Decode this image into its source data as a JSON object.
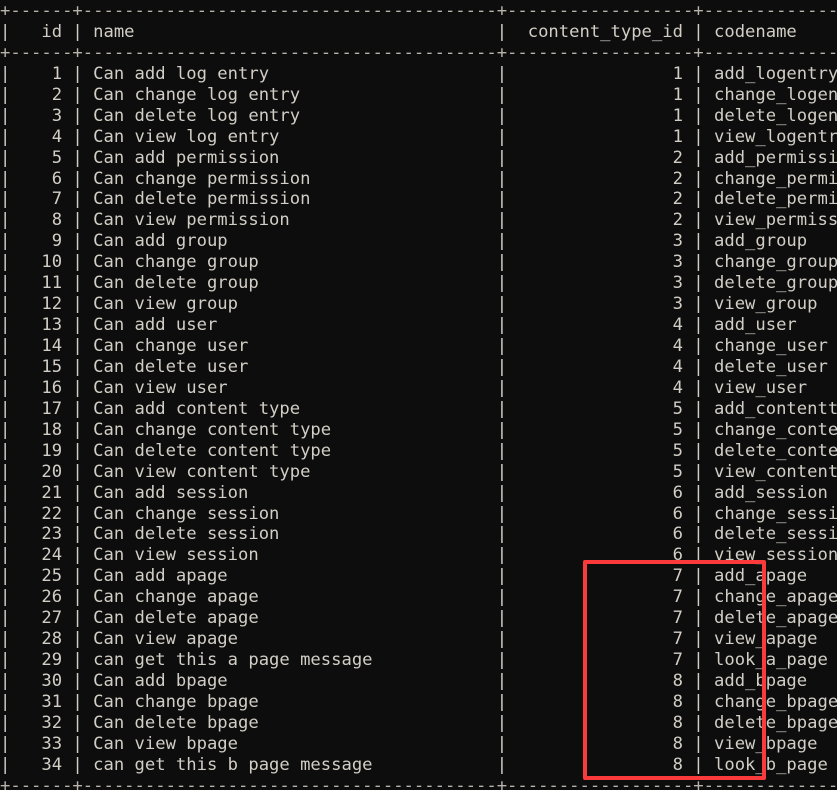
{
  "terminal": {
    "background_color": "#0d0d0d",
    "text_color": "#d2cec6",
    "rule_color": "#b9b4ab",
    "highlight_color": "#fb3b3b"
  },
  "table": {
    "columns": [
      {
        "key": "id",
        "header": "id",
        "width": 4,
        "align": "right"
      },
      {
        "key": "name",
        "header": "name",
        "width": 38,
        "align": "left"
      },
      {
        "key": "content_type_id",
        "header": "content_type_id",
        "width": 16,
        "align": "right"
      },
      {
        "key": "codename",
        "header": "codename",
        "width": 26,
        "align": "left"
      }
    ],
    "rows": [
      {
        "id": "1",
        "name": "Can add log entry",
        "content_type_id": "1",
        "codename": "add_logentry"
      },
      {
        "id": "2",
        "name": "Can change log entry",
        "content_type_id": "1",
        "codename": "change_logentry"
      },
      {
        "id": "3",
        "name": "Can delete log entry",
        "content_type_id": "1",
        "codename": "delete_logentry"
      },
      {
        "id": "4",
        "name": "Can view log entry",
        "content_type_id": "1",
        "codename": "view_logentry"
      },
      {
        "id": "5",
        "name": "Can add permission",
        "content_type_id": "2",
        "codename": "add_permission"
      },
      {
        "id": "6",
        "name": "Can change permission",
        "content_type_id": "2",
        "codename": "change_permission"
      },
      {
        "id": "7",
        "name": "Can delete permission",
        "content_type_id": "2",
        "codename": "delete_permission"
      },
      {
        "id": "8",
        "name": "Can view permission",
        "content_type_id": "2",
        "codename": "view_permission"
      },
      {
        "id": "9",
        "name": "Can add group",
        "content_type_id": "3",
        "codename": "add_group"
      },
      {
        "id": "10",
        "name": "Can change group",
        "content_type_id": "3",
        "codename": "change_group"
      },
      {
        "id": "11",
        "name": "Can delete group",
        "content_type_id": "3",
        "codename": "delete_group"
      },
      {
        "id": "12",
        "name": "Can view group",
        "content_type_id": "3",
        "codename": "view_group"
      },
      {
        "id": "13",
        "name": "Can add user",
        "content_type_id": "4",
        "codename": "add_user"
      },
      {
        "id": "14",
        "name": "Can change user",
        "content_type_id": "4",
        "codename": "change_user"
      },
      {
        "id": "15",
        "name": "Can delete user",
        "content_type_id": "4",
        "codename": "delete_user"
      },
      {
        "id": "16",
        "name": "Can view user",
        "content_type_id": "4",
        "codename": "view_user"
      },
      {
        "id": "17",
        "name": "Can add content type",
        "content_type_id": "5",
        "codename": "add_contenttype"
      },
      {
        "id": "18",
        "name": "Can change content type",
        "content_type_id": "5",
        "codename": "change_contenttype"
      },
      {
        "id": "19",
        "name": "Can delete content type",
        "content_type_id": "5",
        "codename": "delete_contenttype"
      },
      {
        "id": "20",
        "name": "Can view content type",
        "content_type_id": "5",
        "codename": "view_contenttype"
      },
      {
        "id": "21",
        "name": "Can add session",
        "content_type_id": "6",
        "codename": "add_session"
      },
      {
        "id": "22",
        "name": "Can change session",
        "content_type_id": "6",
        "codename": "change_session"
      },
      {
        "id": "23",
        "name": "Can delete session",
        "content_type_id": "6",
        "codename": "delete_session"
      },
      {
        "id": "24",
        "name": "Can view session",
        "content_type_id": "6",
        "codename": "view_session"
      },
      {
        "id": "25",
        "name": "Can add apage",
        "content_type_id": "7",
        "codename": "add_apage"
      },
      {
        "id": "26",
        "name": "Can change apage",
        "content_type_id": "7",
        "codename": "change_apage"
      },
      {
        "id": "27",
        "name": "Can delete apage",
        "content_type_id": "7",
        "codename": "delete_apage"
      },
      {
        "id": "28",
        "name": "Can view apage",
        "content_type_id": "7",
        "codename": "view_apage"
      },
      {
        "id": "29",
        "name": "can get this a page message",
        "content_type_id": "7",
        "codename": "look_a_page"
      },
      {
        "id": "30",
        "name": "Can add bpage",
        "content_type_id": "8",
        "codename": "add_bpage"
      },
      {
        "id": "31",
        "name": "Can change bpage",
        "content_type_id": "8",
        "codename": "change_bpage"
      },
      {
        "id": "32",
        "name": "Can delete bpage",
        "content_type_id": "8",
        "codename": "delete_bpage"
      },
      {
        "id": "33",
        "name": "Can view bpage",
        "content_type_id": "8",
        "codename": "view_bpage"
      },
      {
        "id": "34",
        "name": "can get this b page message",
        "content_type_id": "8",
        "codename": "look_b_page"
      }
    ]
  },
  "annotation": {
    "label": "highlighted-codenames",
    "first_row_id": "25",
    "last_row_id": "34",
    "column": "codename",
    "color": "#fb3b3b"
  }
}
